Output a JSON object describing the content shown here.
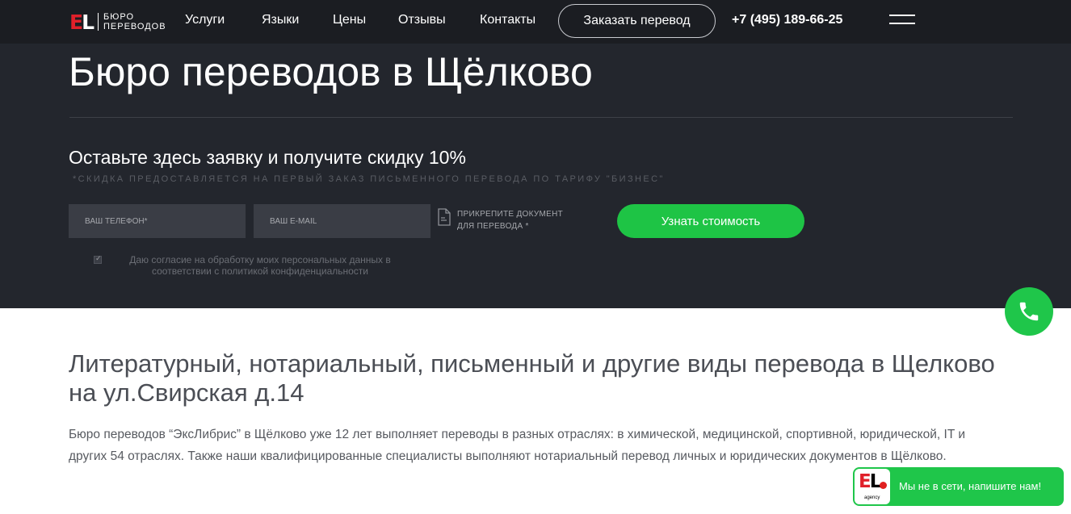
{
  "header": {
    "logo_mark_e": "E",
    "logo_mark_l": "L",
    "logo_line1": "БЮРО",
    "logo_line2": "ПЕРЕВОДОВ",
    "nav": [
      "Услуги",
      "Языки",
      "Цены",
      "Отзывы",
      "Контакты"
    ],
    "order_button": "Заказать перевод",
    "phone": "+7 (495) 189-66-25",
    "menu_icon": "burger-menu-icon"
  },
  "hero": {
    "title": "Бюро переводов в Щёлково",
    "form_title": "Оставьте здесь заявку и получите скидку 10%",
    "form_note": "*СКИДКА ПРЕДОСТАВЛЯЕТСЯ НА ПЕРВЫЙ ЗАКАЗ ПИСЬМЕННОГО ПЕРЕВОДА ПО ТАРИФУ \"БИЗНЕС\"",
    "phone_placeholder": "ВАШ ТЕЛЕФОН*",
    "email_placeholder": "ВАШ E-MAIL",
    "attach_line1": "ПРИКРЕПИТЕ ДОКУМЕНТ",
    "attach_line2": "ДЛЯ ПЕРЕВОДА *",
    "submit": "Узнать стоимость",
    "consent_line1": "Даю согласие на обработку моих персональных данных в",
    "consent_line2": "соответствии с политикой конфиденциальности"
  },
  "content": {
    "title": "Литературный, нотариальный, письменный и другие виды перевода в Щелково на ул.Свирская д.14",
    "text": "Бюро переводов “ЭксЛибрис” в Щёлково уже 12 лет выполняет переводы в разных отраслях: в химической, медицинской, спортивной, юридической, IT и других 54 отраслях. Также наши квалифицированные специалисты выполняют нотариальный перевод личных и юридических документов в Щёлково."
  },
  "chat": {
    "logo_e": "E",
    "logo_l": "L",
    "logo_sub": "agency",
    "text": "Мы не в сети, напишите нам!"
  },
  "colors": {
    "dark_bg": "#23262d",
    "accent_green": "#1ec445",
    "logo_red": "#e0202a"
  }
}
